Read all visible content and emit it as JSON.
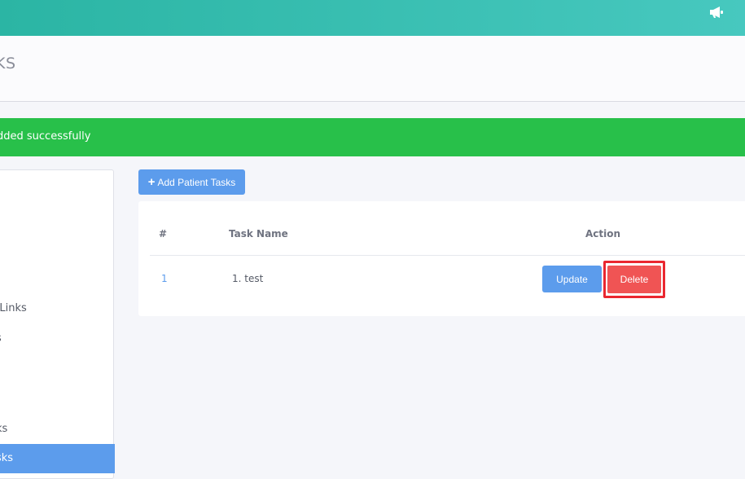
{
  "header": {
    "title": "KS"
  },
  "alert": {
    "message": "dded successfully"
  },
  "sidebar": {
    "items": [
      {
        "label": "/Links"
      },
      {
        "label": "s"
      },
      {
        "label": "ks"
      },
      {
        "label": "sks",
        "active": true
      }
    ]
  },
  "toolbar": {
    "add_label": "Add Patient Tasks"
  },
  "table": {
    "columns": [
      "#",
      "Task Name",
      "Action"
    ],
    "rows": [
      {
        "num": "1",
        "task": "1. test",
        "update_label": "Update",
        "delete_label": "Delete"
      }
    ]
  },
  "colors": {
    "topbar": "#2bb5a4",
    "success": "#28c04a",
    "primary": "#5c9cec",
    "danger": "#f05454",
    "highlight": "#ea2730"
  },
  "icons": {
    "topbar": "megaphone-icon",
    "add": "plus-icon"
  }
}
